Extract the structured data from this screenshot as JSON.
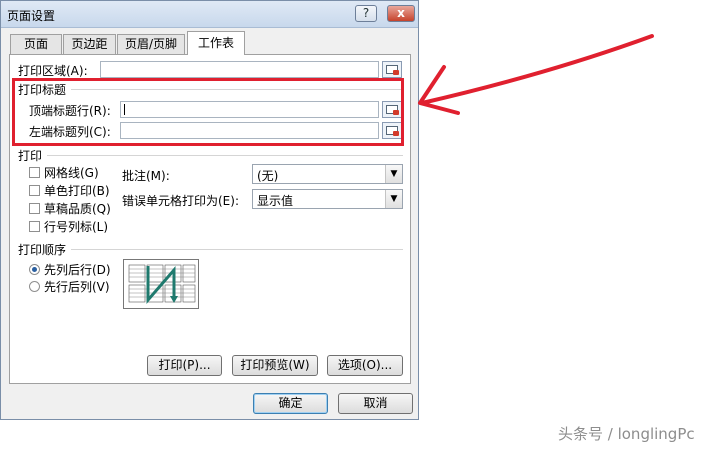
{
  "window": {
    "title": "页面设置"
  },
  "titlebar_buttons": {
    "help": "?",
    "close": "x"
  },
  "tabs": [
    {
      "label": "页面"
    },
    {
      "label": "页边距"
    },
    {
      "label": "页眉/页脚"
    },
    {
      "label": "工作表"
    }
  ],
  "print_area": {
    "label": "打印区域(A):",
    "value": ""
  },
  "print_titles": {
    "group_label": "打印标题",
    "rows_label": "顶端标题行(R):",
    "rows_value": "",
    "cols_label": "左端标题列(C):",
    "cols_value": ""
  },
  "print": {
    "group_label": "打印",
    "gridlines": {
      "label": "网格线(G)",
      "checked": false
    },
    "black_white": {
      "label": "单色打印(B)",
      "checked": false
    },
    "draft": {
      "label": "草稿品质(Q)",
      "checked": false
    },
    "headings": {
      "label": "行号列标(L)",
      "checked": false
    },
    "comments_label": "批注(M):",
    "comments_value": "(无)",
    "errors_label": "错误单元格打印为(E):",
    "errors_value": "显示值"
  },
  "page_order": {
    "group_label": "打印顺序",
    "down_then_over": {
      "label": "先列后行(D)",
      "selected": true
    },
    "over_then_down": {
      "label": "先行后列(V)",
      "selected": false
    }
  },
  "buttons": {
    "print": "打印(P)...",
    "print_preview": "打印预览(W)",
    "options": "选项(O)...",
    "ok": "确定",
    "cancel": "取消"
  },
  "annotation": {
    "highlight_color": "#e0202f"
  },
  "watermark": "头条号 / longlingPc"
}
